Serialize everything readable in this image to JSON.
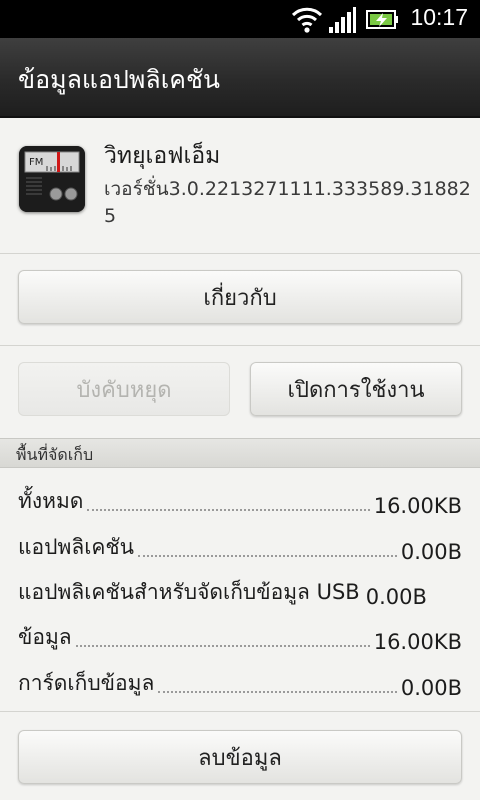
{
  "status_bar": {
    "time": "10:17",
    "icons": [
      "wifi-icon",
      "signal-icon",
      "battery-charging-icon"
    ]
  },
  "title_bar": {
    "title": "ข้อมูลแอปพลิเคชัน"
  },
  "app": {
    "name": "วิทยุเอฟเอ็ม",
    "version": "เวอร์ชั่น3.0.2213271111.333589.318825",
    "icon": "fm-radio-icon",
    "icon_text": "FM"
  },
  "buttons": {
    "about": "เกี่ยวกับ",
    "force_stop": "บังคับหยุด",
    "enable": "เปิดการใช้งาน",
    "clear_data": "ลบข้อมูล"
  },
  "storage": {
    "header": "พื้นที่จัดเก็บ",
    "rows": [
      {
        "label": "ทั้งหมด",
        "value": "16.00KB"
      },
      {
        "label": "แอปพลิเคชัน",
        "value": "0.00B"
      },
      {
        "label": "แอปพลิเคชันสำหรับจัดเก็บข้อมูล USB",
        "value": "0.00B"
      },
      {
        "label": "ข้อมูล",
        "value": "16.00KB"
      },
      {
        "label": "การ์ดเก็บข้อมูล",
        "value": "0.00B"
      }
    ]
  }
}
